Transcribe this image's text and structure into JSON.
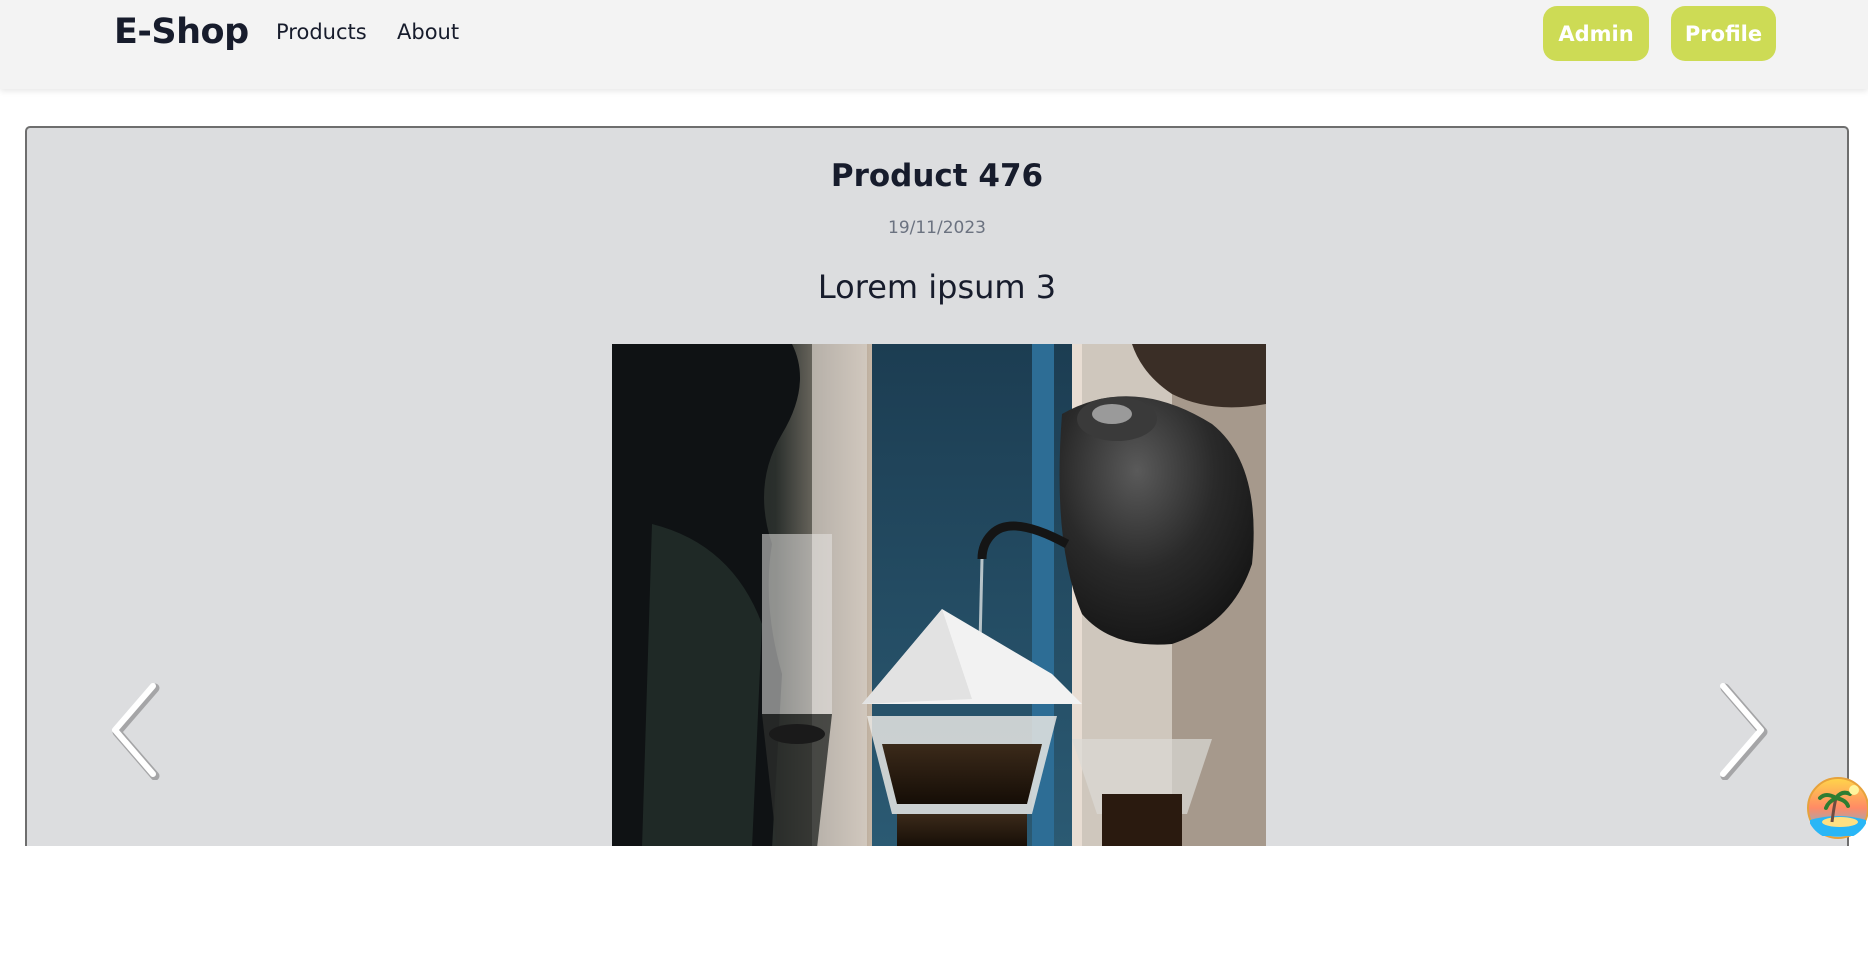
{
  "navbar": {
    "brand": "E-Shop",
    "links": [
      "Products",
      "About"
    ],
    "admin_label": "Admin",
    "profile_label": "Profile"
  },
  "product": {
    "title": "Product 476",
    "date": "19/11/2023",
    "subtitle": "Lorem ipsum 3",
    "image_icon": "coffee-pour-over-photo"
  },
  "carousel": {
    "prev_icon": "chevron-left-icon",
    "next_icon": "chevron-right-icon"
  },
  "floating": {
    "icon": "island-palm-icon"
  },
  "colors": {
    "accent": "#cddb55",
    "navbar_bg": "#f3f3f3",
    "card_bg": "#dcdddf",
    "text_dark": "#171c2c",
    "text_muted": "#6b7280"
  }
}
